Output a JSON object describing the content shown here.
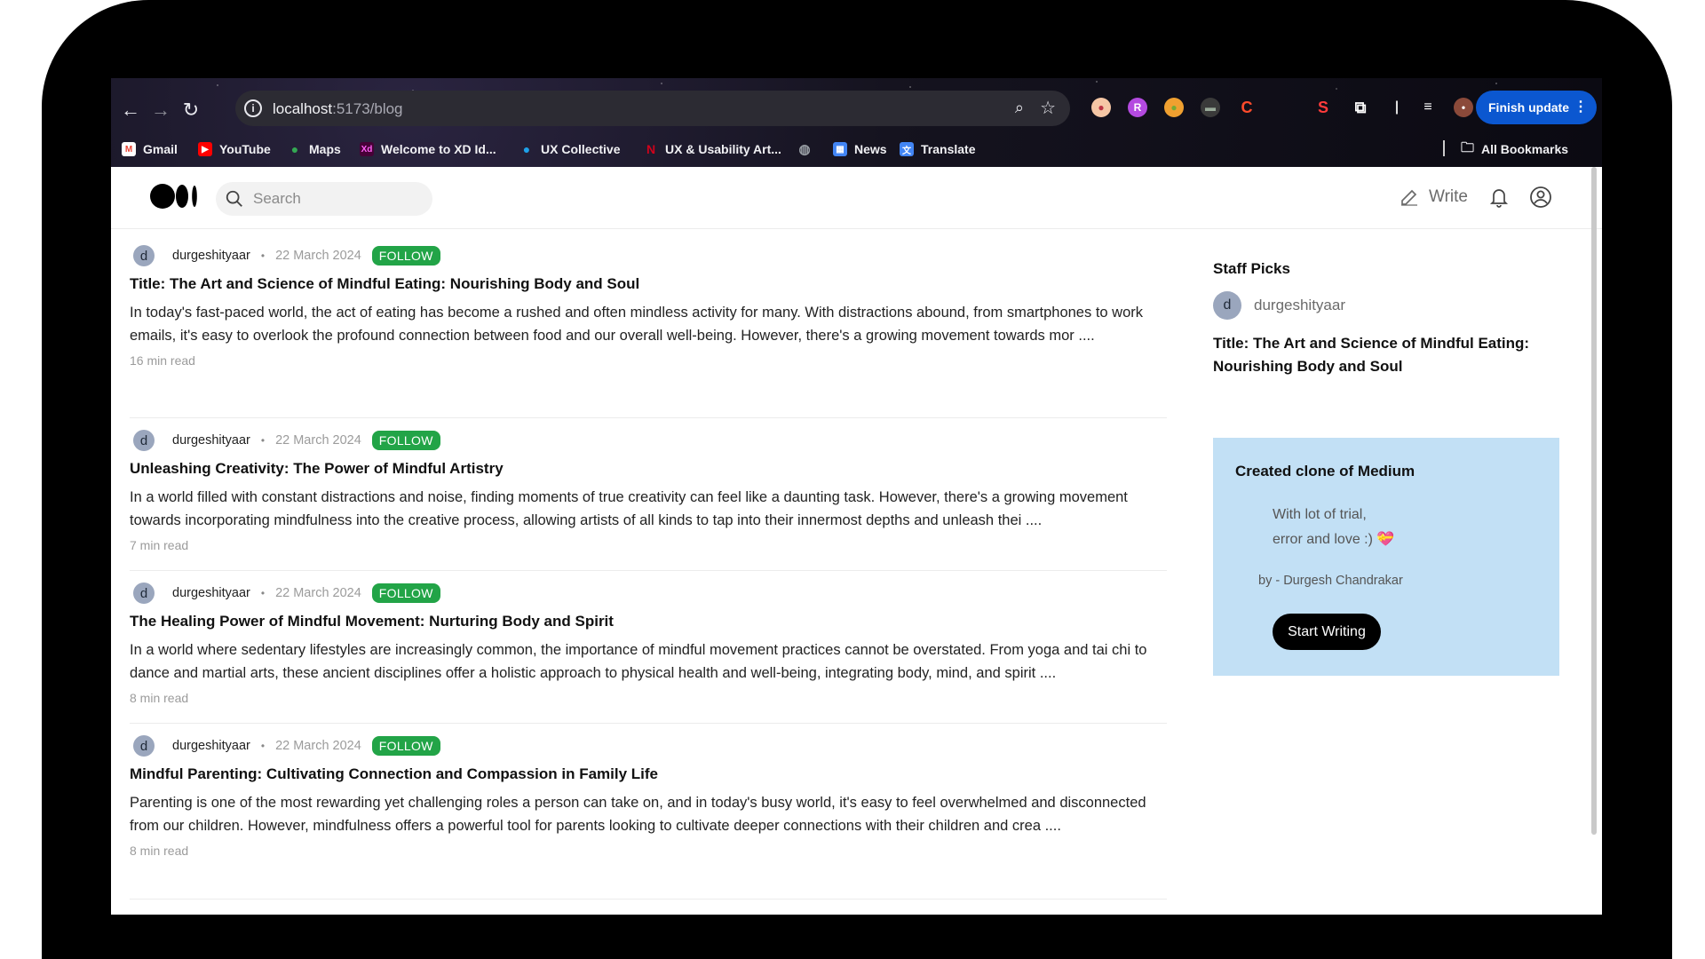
{
  "browser": {
    "url_host": "localhost",
    "url_path": ":5173/blog",
    "finish_update_label": "Finish update",
    "bookmarks": [
      {
        "label": "Gmail",
        "icon": "gmail-icon",
        "color": "#ea4335"
      },
      {
        "label": "YouTube",
        "icon": "youtube-icon",
        "color": "#ff0000"
      },
      {
        "label": "Maps",
        "icon": "maps-icon",
        "color": "#34a853"
      },
      {
        "label": "Welcome to XD Id...",
        "icon": "xd-icon",
        "color": "#470137"
      },
      {
        "label": "UX Collective",
        "icon": "uxcollective-icon",
        "color": "#1ea1e9"
      },
      {
        "label": "UX & Usability Art...",
        "icon": "nngroup-icon",
        "color": "#d0021b"
      },
      {
        "label": "",
        "icon": "globe-icon",
        "color": "#9aa0a6"
      },
      {
        "label": "News",
        "icon": "news-icon",
        "color": "#4285f4"
      },
      {
        "label": "Translate",
        "icon": "translate-icon",
        "color": "#4285f4"
      }
    ],
    "all_bookmarks_label": "All Bookmarks"
  },
  "header": {
    "search_placeholder": "Search",
    "write_label": "Write"
  },
  "posts": [
    {
      "author_initial": "d",
      "author": "durgeshityaar",
      "date": "22 March 2024",
      "follow_label": "FOLLOW",
      "title": "Title: The Art and Science of Mindful Eating: Nourishing Body and Soul",
      "body": "In today's fast-paced world, the act of eating has become a rushed and often mindless activity for many. With distractions abound, from smartphones to work emails, it's easy to overlook the profound connection between food and our overall well-being. However, there's a growing movement towards mor ....",
      "read_time": "16 min read"
    },
    {
      "author_initial": "d",
      "author": "durgeshityaar",
      "date": "22 March 2024",
      "follow_label": "FOLLOW",
      "title": "Unleashing Creativity: The Power of Mindful Artistry",
      "body": "In a world filled with constant distractions and noise, finding moments of true creativity can feel like a daunting task. However, there's a growing movement towards incorporating mindfulness into the creative process, allowing artists of all kinds to tap into their innermost depths and unleash thei ....",
      "read_time": "7 min read"
    },
    {
      "author_initial": "d",
      "author": "durgeshityaar",
      "date": "22 March 2024",
      "follow_label": "FOLLOW",
      "title": "The Healing Power of Mindful Movement: Nurturing Body and Spirit",
      "body": "In a world where sedentary lifestyles are increasingly common, the importance of mindful movement practices cannot be overstated. From yoga and tai chi to dance and martial arts, these ancient disciplines offer a holistic approach to physical health and well-being, integrating body, mind, and spirit ....",
      "read_time": "8 min read"
    },
    {
      "author_initial": "d",
      "author": "durgeshityaar",
      "date": "22 March 2024",
      "follow_label": "FOLLOW",
      "title": "Mindful Parenting: Cultivating Connection and Compassion in Family Life",
      "body": "Parenting is one of the most rewarding yet challenging roles a person can take on, and in today's busy world, it's easy to feel overwhelmed and disconnected from our children. However, mindfulness offers a powerful tool for parents looking to cultivate deeper connections with their children and crea ....",
      "read_time": "8 min read"
    }
  ],
  "sidebar": {
    "staff_picks_title": "Staff Picks",
    "staff_author_initial": "d",
    "staff_author": "durgeshityaar",
    "staff_post_title": "Title: The Art and Science of Mindful Eating: Nourishing Body and Soul",
    "card_title": "Created clone of Medium",
    "card_line1": "With lot of trial,",
    "card_line2": "error and love :)",
    "card_emoji": "💝",
    "card_by": "by - Durgesh Chandrakar",
    "start_writing_label": "Start Writing"
  },
  "colors": {
    "follow_green": "#22a447",
    "card_blue": "#c2e0f5",
    "finish_update_blue": "#0b57d0"
  }
}
